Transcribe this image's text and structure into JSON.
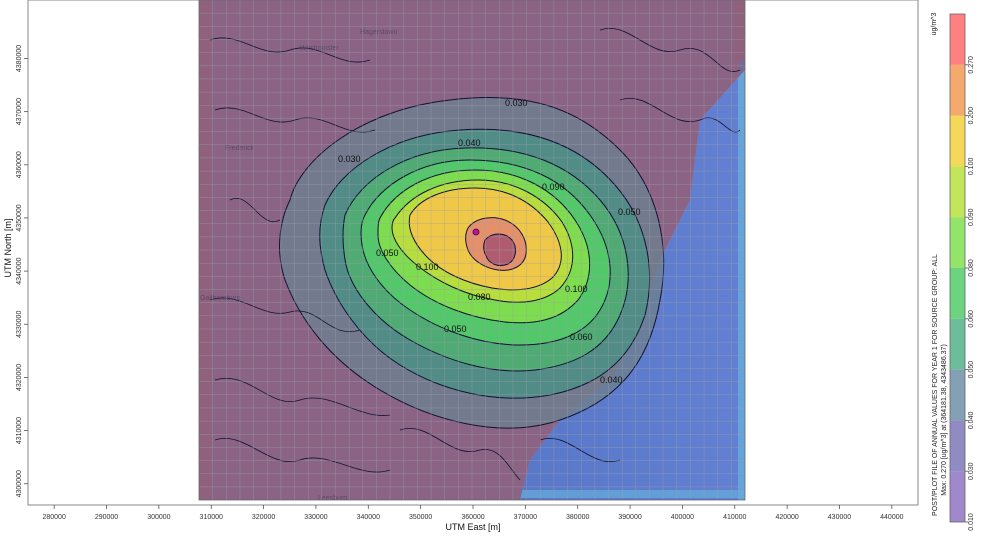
{
  "axes": {
    "xlabel": "UTM East [m]",
    "ylabel": "UTM North [m]",
    "xticks": [
      280000,
      290000,
      300000,
      310000,
      320000,
      330000,
      340000,
      350000,
      360000,
      370000,
      380000,
      390000,
      400000,
      410000,
      420000,
      430000,
      440000
    ],
    "yticks": [
      4300000,
      4310000,
      4320000,
      4330000,
      4340000,
      4350000,
      4360000,
      4370000,
      4380000
    ]
  },
  "legend": {
    "unit": "ug/m^3",
    "levels": [
      "0.010",
      "0.030",
      "0.040",
      "0.050",
      "0.060",
      "0.080",
      "0.090",
      "0.100",
      "0.200",
      "0.270"
    ],
    "colors": [
      "#8f73c4",
      "#7e77b8",
      "#6f8fa8",
      "#52b38a",
      "#52cd6a",
      "#7fe04e",
      "#b8e03c",
      "#f2d23c",
      "#f39a52",
      "#ff6a6a"
    ],
    "caption_1": "POST/PLOT FILE OF ANNUAL VALUES FOR YEAR 1 FOR SOURCE GROUP: ALL",
    "caption_2": "Max: 0.270 [ug/m^3] at (364181.38, 4343486.37)"
  },
  "contour_labels": [
    "0.030",
    "0.030",
    "0.040",
    "0.040",
    "0.050",
    "0.050",
    "0.050",
    "0.060",
    "0.080",
    "0.090",
    "0.100",
    "0.100"
  ],
  "map_labels": [
    "Westminster",
    "Hagerstown",
    "Frederick",
    "Gaithersburg",
    "Alexandria",
    "Leesburg"
  ],
  "colors": {
    "map_bg": "#c8b9a4",
    "overlay": "#7a4a7c",
    "contour_line": "#111133",
    "source_marker": "#c0139a"
  },
  "chart_data": {
    "type": "heatmap",
    "title": "",
    "xlabel": "UTM East [m]",
    "ylabel": "UTM North [m]",
    "xlim": [
      275000,
      445000
    ],
    "ylim": [
      4296000,
      4391000
    ],
    "max_value": 0.27,
    "max_location": [
      364181.38,
      4343486.37
    ],
    "contour_levels": [
      0.01,
      0.03,
      0.04,
      0.05,
      0.06,
      0.08,
      0.09,
      0.1,
      0.2,
      0.27
    ]
  }
}
